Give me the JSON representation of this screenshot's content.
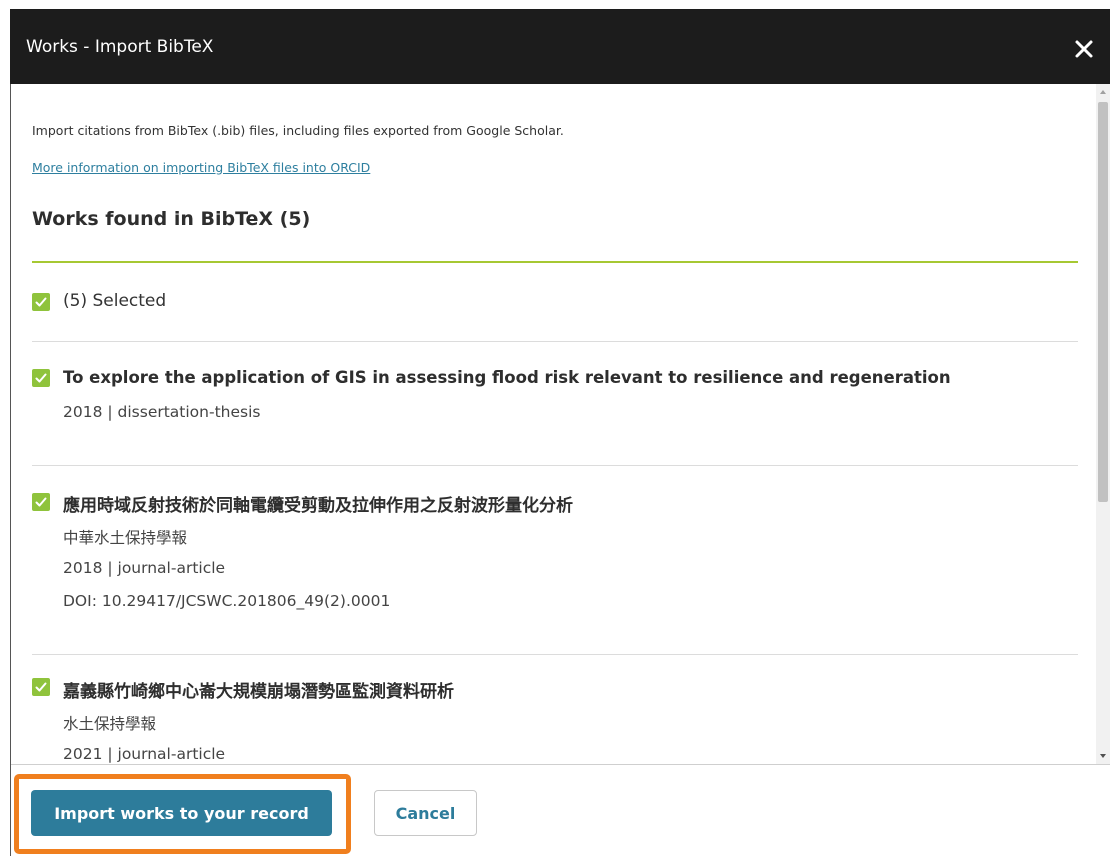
{
  "dialog": {
    "title": "Works - Import BibTeX",
    "close_icon": "close-icon"
  },
  "intro": {
    "text": "Import citations from BibTex (.bib) files, including files exported from Google Scholar.",
    "link": "More information on importing BibTeX files into ORCID"
  },
  "section": {
    "title": "Works found in BibTeX (5)"
  },
  "select_all": {
    "label": "(5) Selected",
    "checked": true
  },
  "works": [
    {
      "title": "To explore the application of GIS in assessing flood risk relevant to resilience and regeneration",
      "meta1": "2018 | dissertation-thesis",
      "checked": true
    },
    {
      "title": "應用時域反射技術於同軸電纜受剪動及拉伸作用之反射波形量化分析",
      "journal": "中華水土保持學報",
      "meta1": "2018 | journal-article",
      "doi": "DOI: 10.29417/JCSWC.201806_49(2).0001",
      "checked": true
    },
    {
      "title": "嘉義縣竹崎鄉中心崙大規模崩塌潛勢區監測資料研析",
      "journal": "水土保持學報",
      "meta1": "2021 | journal-article",
      "checked": true
    }
  ],
  "footer": {
    "import_label": "Import works to your record",
    "cancel_label": "Cancel"
  },
  "colors": {
    "header_bg": "#1c1c1c",
    "accent_green": "#8fc33c",
    "primary_button": "#2d7c9b",
    "highlight_orange": "#f07f1e"
  }
}
